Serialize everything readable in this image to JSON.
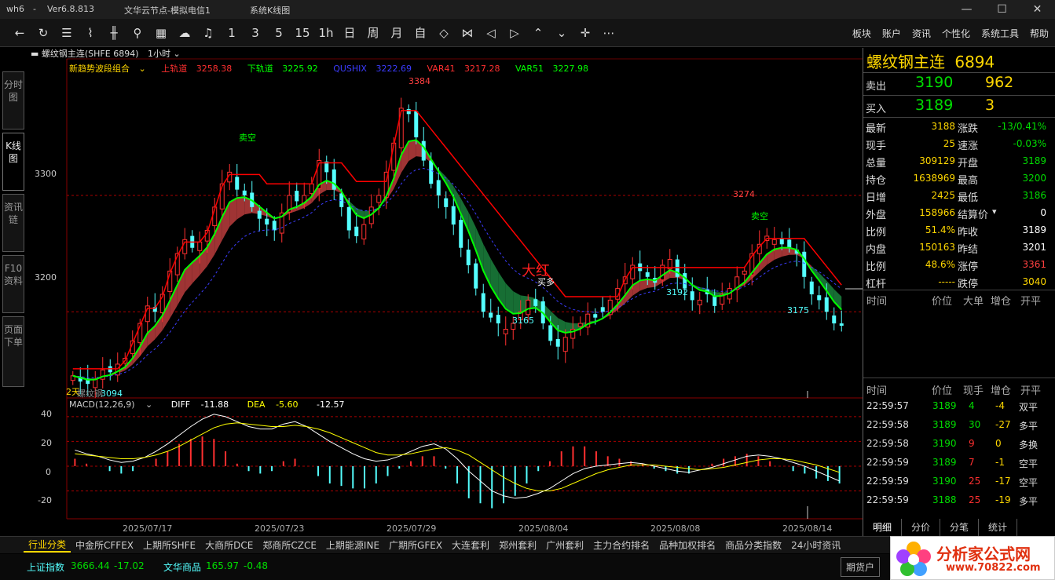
{
  "titlebar": {
    "app_name": "wh6",
    "version": "Ver6.8.813",
    "server": "文华云节点-模拟电信1",
    "window_name": "系统K线图",
    "minimize": "—",
    "maximize": "☐",
    "close": "✕"
  },
  "toolbar": {
    "icons": [
      "back-arrow-icon",
      "refresh-icon",
      "list-icon",
      "line-chart-icon",
      "kline-icon",
      "tick-icon",
      "grid-icon",
      "cloud-icon",
      "bell-icon"
    ],
    "periods": [
      "1",
      "3",
      "5",
      "15",
      "1h",
      "日",
      "周",
      "月",
      "自"
    ],
    "menu": [
      "板块",
      "账户",
      "资讯",
      "个性化",
      "系统工具",
      "帮助"
    ]
  },
  "left_tabs": [
    "分时图",
    "K线图",
    "资讯链",
    "F10资料",
    "页面下单"
  ],
  "chart_header": {
    "symbol_line": "螺纹钢主连(SHFE 6894)",
    "period": "1小时"
  },
  "main_legend": {
    "indicator": "新趋势波段组合",
    "upper_label": "上轨道",
    "upper_value": "3258.38",
    "lower_label": "下轨道",
    "lower_value": "3225.92",
    "qushix_label": "QUSHIX",
    "qushix_value": "3222.69",
    "var41_label": "VAR41",
    "var41_value": "3217.28",
    "var51_label": "VAR51",
    "var51_value": "3227.98"
  },
  "macd_legend": {
    "name": "MACD(12,26,9)",
    "diff_label": "DIFF",
    "diff_value": "-11.88",
    "dea_label": "DEA",
    "dea_value": "-5.60",
    "macd_value": "-12.57"
  },
  "price_annotations": [
    "3384",
    "3274",
    "3165",
    "3192",
    "3175",
    "3094"
  ],
  "signal_labels": {
    "sell_short": "卖空",
    "buy_long": "买多",
    "big_red": "大红",
    "days": "2天",
    "name_tag": "螺纹钢"
  },
  "price_axis": [
    "3300",
    "3200"
  ],
  "macd_axis": [
    "40",
    "20",
    "0",
    "-20"
  ],
  "date_axis": [
    "2025/07/17",
    "2025/07/23",
    "2025/07/29",
    "2025/08/04",
    "2025/08/08",
    "2025/08/14"
  ],
  "right_panel": {
    "title": "螺纹钢主连",
    "code": "6894",
    "sell": {
      "label": "卖出",
      "price": "3190",
      "volume": "962"
    },
    "buy": {
      "label": "买入",
      "price": "3189",
      "volume": "3"
    },
    "quotes": [
      {
        "k1": "最新",
        "v1": "3188",
        "k2": "涨跌",
        "v2": "-13/0.41%",
        "c2": "#00dd00"
      },
      {
        "k1": "现手",
        "v1": "25",
        "k2": "速涨",
        "v2": "-0.03%",
        "c2": "#00dd00"
      },
      {
        "k1": "总量",
        "v1": "309129",
        "k2": "开盘",
        "v2": "3189",
        "c2": "#00dd00"
      },
      {
        "k1": "持仓",
        "v1": "1638969",
        "k2": "最高",
        "v2": "3200",
        "c2": "#00dd00"
      },
      {
        "k1": "日增",
        "v1": "2425",
        "k2": "最低",
        "v2": "3186",
        "c2": "#00dd00"
      },
      {
        "k1": "外盘",
        "v1": "158966",
        "k2": "结算价",
        "v2": "0",
        "c2": "#ffffff"
      },
      {
        "k1": "比例",
        "v1": "51.4%",
        "k2": "昨收",
        "v2": "3189",
        "c2": "#ffffff"
      },
      {
        "k1": "内盘",
        "v1": "150163",
        "k2": "昨结",
        "v2": "3201",
        "c2": "#ffffff"
      },
      {
        "k1": "比例",
        "v1": "48.6%",
        "k2": "涨停",
        "v2": "3361",
        "c2": "#ff4040"
      },
      {
        "k1": "杠杆",
        "v1": "-----",
        "k2": "跌停",
        "v2": "3040",
        "c2": "#ffd700"
      }
    ],
    "table_headers": [
      "时间",
      "价位",
      "大单",
      "增仓",
      "开平"
    ],
    "detail_headers": [
      "时间",
      "价位",
      "现手",
      "增仓",
      "开平"
    ],
    "ticks": [
      {
        "time": "22:59:57",
        "price": "3189",
        "vol": "4",
        "oi": "-4",
        "type": "双平"
      },
      {
        "time": "22:59:58",
        "price": "3189",
        "vol": "30",
        "oi": "-27",
        "type": "多平"
      },
      {
        "time": "22:59:58",
        "price": "3190",
        "vol": "9",
        "oi": "0",
        "type": "多换"
      },
      {
        "time": "22:59:59",
        "price": "3189",
        "vol": "7",
        "oi": "-1",
        "type": "空平"
      },
      {
        "time": "22:59:59",
        "price": "3190",
        "vol": "25",
        "oi": "-17",
        "type": "空平"
      },
      {
        "time": "22:59:59",
        "price": "3188",
        "vol": "25",
        "oi": "-19",
        "type": "多平"
      }
    ],
    "tabs": [
      "明细",
      "分价",
      "分笔",
      "统计"
    ]
  },
  "bottom_tabs": [
    "行业分类",
    "中金所CFFEX",
    "上期所SHFE",
    "大商所DCE",
    "郑商所CZCE",
    "上期能源INE",
    "广期所GFEX",
    "大连套利",
    "郑州套利",
    "广州套利",
    "主力合约排名",
    "品种加权排名",
    "商品分类指数",
    "24小时资讯"
  ],
  "statusbar": {
    "idx1_name": "上证指数",
    "idx1_value": "3666.44",
    "idx1_change": "-17.02",
    "idx2_name": "文华商品",
    "idx2_value": "165.97",
    "idx2_change": "-0.48",
    "button": "期货户"
  },
  "watermark": {
    "title": "分析家公式网",
    "url": "www.70822.com"
  },
  "colors": {
    "up": "#ff3030",
    "down": "#54ffff",
    "upper_band": "#ff0000",
    "lower_band": "#00ff00",
    "ribbon_up": "#b03a3a",
    "ribbon_down": "#1a7a3a",
    "accent": "#ffd700"
  },
  "chart_data": [
    {
      "type": "candlestick",
      "title": "螺纹钢主连(SHFE 6894) 1小时",
      "ylim": [
        3130,
        3410
      ],
      "x": [
        "2025/07/17",
        "2025/07/23",
        "2025/07/29",
        "2025/08/04",
        "2025/08/08",
        "2025/08/14"
      ],
      "annotations": [
        {
          "label": "3384",
          "value": 3384
        },
        {
          "label": "3274",
          "value": 3274
        },
        {
          "label": "3165",
          "value": 3165
        },
        {
          "label": "3192",
          "value": 3192
        },
        {
          "label": "3175",
          "value": 3175
        },
        {
          "label": "3094",
          "value": 3094
        }
      ],
      "close_trend": [
        3145,
        3140,
        3138,
        3142,
        3150,
        3148,
        3155,
        3160,
        3175,
        3190,
        3205,
        3200,
        3215,
        3235,
        3250,
        3262,
        3255,
        3260,
        3270,
        3290,
        3310,
        3320,
        3305,
        3300,
        3290,
        3280,
        3275,
        3270,
        3285,
        3300,
        3295,
        3300,
        3310,
        3330,
        3320,
        3305,
        3290,
        3270,
        3265,
        3275,
        3290,
        3300,
        3320,
        3345,
        3375,
        3370,
        3350,
        3330,
        3310,
        3300,
        3290,
        3275,
        3255,
        3240,
        3220,
        3200,
        3195,
        3190,
        3185,
        3190,
        3200,
        3210,
        3205,
        3190,
        3175,
        3170,
        3178,
        3185,
        3190,
        3198,
        3195,
        3200,
        3210,
        3220,
        3230,
        3240,
        3235,
        3230,
        3225,
        3240,
        3245,
        3230,
        3220,
        3210,
        3210,
        3215,
        3205,
        3215,
        3220,
        3230,
        3235,
        3250,
        3258,
        3265,
        3262,
        3258,
        3255,
        3250,
        3230,
        3215,
        3210,
        3200,
        3190,
        3188
      ]
    },
    {
      "type": "macd",
      "title": "MACD(12,26,9)",
      "ylim": [
        -40,
        45
      ],
      "diff": [
        13,
        10,
        8,
        5,
        3,
        4,
        7,
        12,
        18,
        25,
        32,
        38,
        42,
        40,
        36,
        32,
        30,
        30,
        34,
        36,
        32,
        26,
        20,
        15,
        10,
        6,
        4,
        5,
        8,
        12,
        16,
        18,
        14,
        6,
        -4,
        -12,
        -20,
        -24,
        -26,
        -25,
        -22,
        -18,
        -12,
        -6,
        -2,
        0,
        1,
        2,
        3,
        2,
        0,
        -2,
        -4,
        -5,
        -3,
        -1,
        2,
        5,
        8,
        9,
        8,
        6,
        3,
        0,
        -4,
        -8,
        -12
      ],
      "dea": [
        10,
        9,
        8,
        7,
        6,
        6,
        7,
        9,
        12,
        16,
        21,
        26,
        31,
        34,
        35,
        34,
        33,
        32,
        32,
        33,
        32,
        30,
        27,
        23,
        19,
        15,
        11,
        9,
        9,
        10,
        12,
        14,
        15,
        13,
        9,
        3,
        -3,
        -9,
        -14,
        -18,
        -20,
        -20,
        -18,
        -14,
        -10,
        -6,
        -3,
        -1,
        1,
        1,
        1,
        0,
        -1,
        -2,
        -3,
        -2,
        -1,
        1,
        3,
        5,
        6,
        6,
        5,
        3,
        1,
        -2,
        -5
      ]
    }
  ]
}
